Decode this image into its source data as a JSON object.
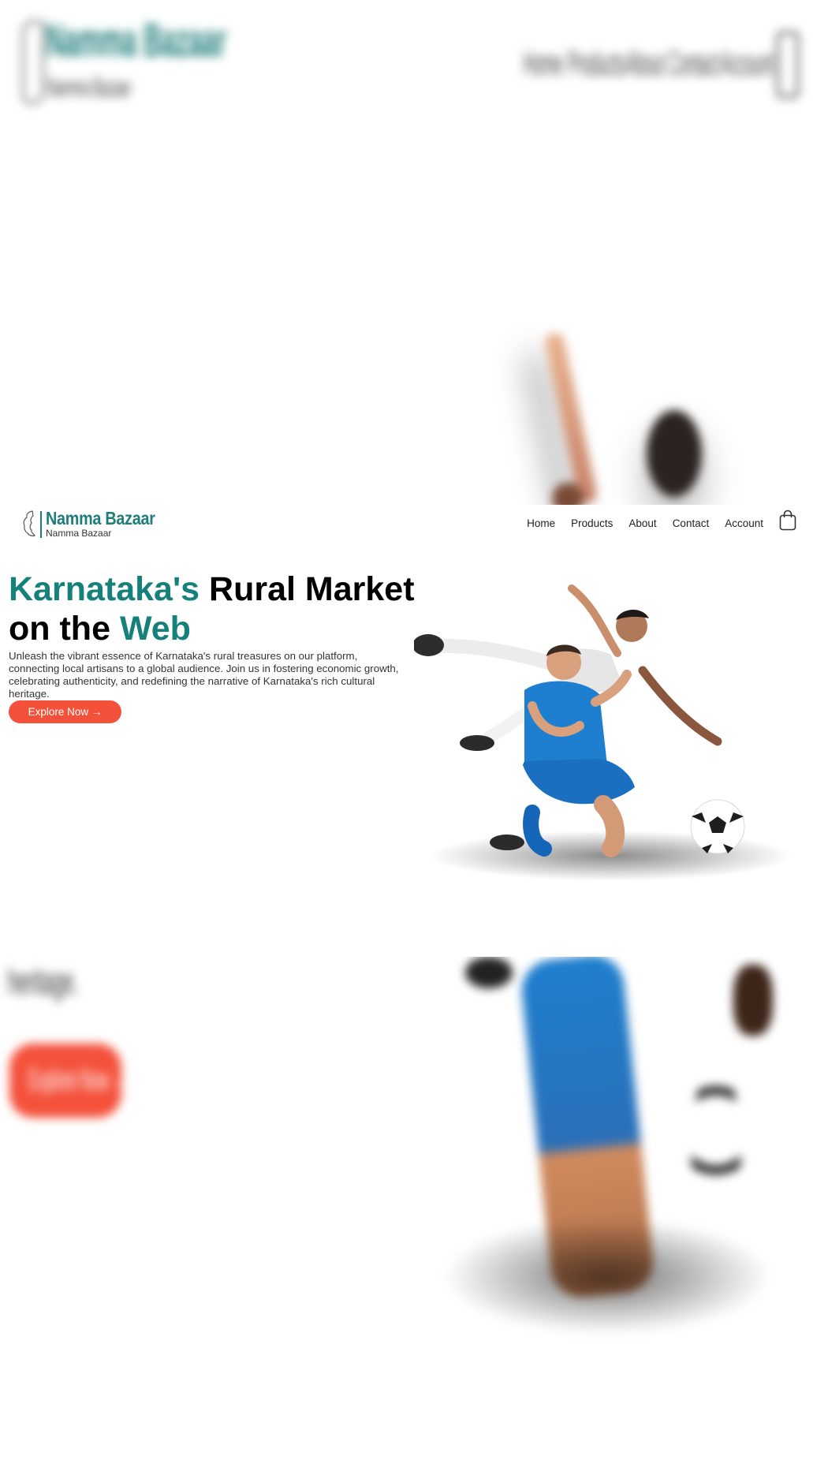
{
  "brand": {
    "name": "Namma Bazaar",
    "tagline": "Namma Bazaar",
    "color": "#1e7d7a"
  },
  "nav": {
    "items": [
      {
        "label": "Home"
      },
      {
        "label": "Products"
      },
      {
        "label": "About"
      },
      {
        "label": "Contact"
      },
      {
        "label": "Account"
      }
    ],
    "cart_icon": "shopping-bag-icon"
  },
  "hero": {
    "title_part1": "Karnataka's",
    "title_part2": " Rural Market",
    "title_part3": "on the ",
    "title_part4": "Web",
    "description": "Unleash the vibrant essence of Karnataka's rural treasures on our platform, connecting local artisans to a global audience. Join us in fostering economic growth, celebrating authenticity, and redefining the narrative of Karnataka's rich cultural heritage.",
    "cta_label": "Explore Now →",
    "accent_color": "#16807b",
    "cta_color": "#f4513b",
    "image": "soccer-players-celebration-image"
  },
  "blurred_artifacts": {
    "bottom_text": "heritage.",
    "bottom_button_label": "Explore Now →"
  }
}
